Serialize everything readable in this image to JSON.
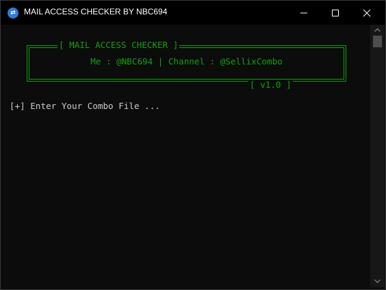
{
  "window": {
    "title": "MAIL ACCESS CHECKER BY NBC694",
    "icon": "app-icon",
    "controls": [
      "minimize-icon",
      "maximize-icon",
      "close-icon"
    ]
  },
  "console": {
    "banner": {
      "title": "[ MAIL ACCESS CHECKER ]",
      "info": "Me : @NBC694 | Channel : @SellixCombo",
      "version": "[ v1.0 ]"
    },
    "prompt": "[+] Enter Your Combo File ..."
  },
  "colors": {
    "background": "#0c0c0c",
    "titlebar": "#000000",
    "banner_text": "#13a10e",
    "prompt_text": "#cccccc",
    "app_icon": "#2f7bd9"
  }
}
